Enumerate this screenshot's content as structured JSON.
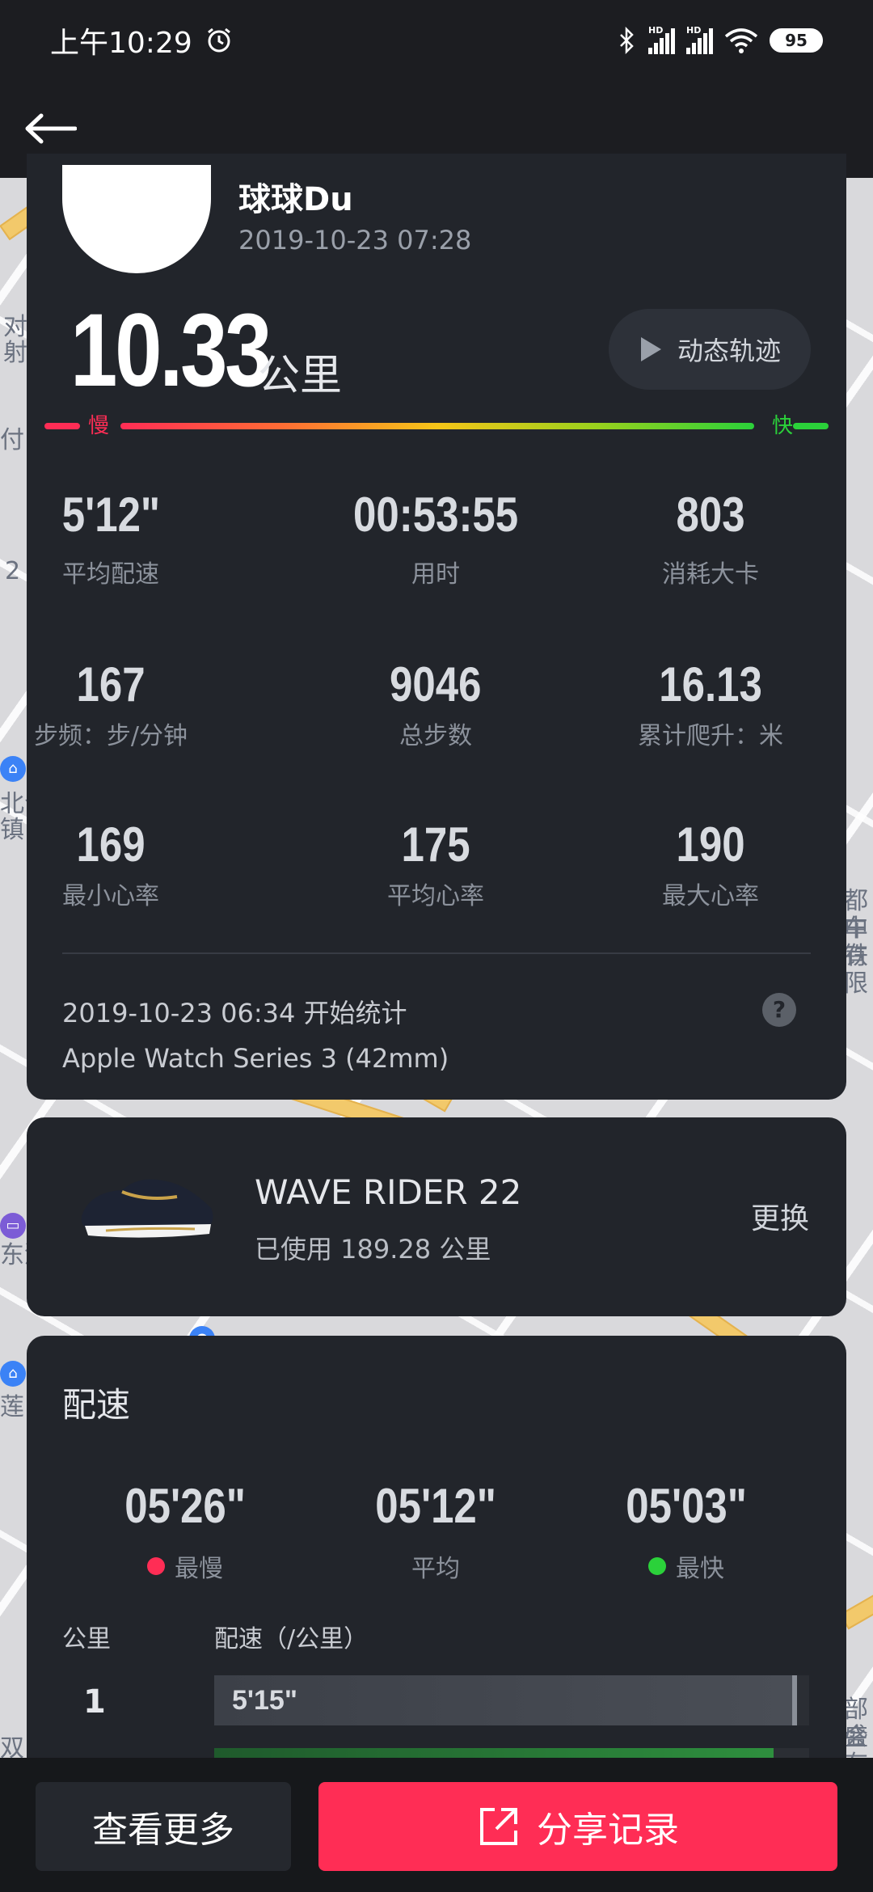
{
  "status_bar": {
    "time": "上午10:29",
    "battery": "95"
  },
  "nav": {
    "back_icon": "arrow-left-icon"
  },
  "summary": {
    "user_name": "球球Du",
    "record_time": "2019-10-23 07:28",
    "distance": "10.33",
    "distance_unit": "公里",
    "track_button": "动态轨迹",
    "pace_scale": {
      "slow": "慢",
      "fast": "快"
    },
    "stats": [
      {
        "value": "5'12\"",
        "label": "平均配速"
      },
      {
        "value": "00:53:55",
        "label": "用时"
      },
      {
        "value": "803",
        "label": "消耗大卡"
      },
      {
        "value": "167",
        "label": "步频：步/分钟"
      },
      {
        "value": "9046",
        "label": "总步数"
      },
      {
        "value": "16.13",
        "label": "累计爬升：米"
      },
      {
        "value": "169",
        "label": "最小心率"
      },
      {
        "value": "175",
        "label": "平均心率"
      },
      {
        "value": "190",
        "label": "最大心率"
      }
    ],
    "start_info": "2019-10-23 06:34  开始统计",
    "device": "Apple Watch Series 3 (42mm)",
    "help_icon": "?"
  },
  "shoe": {
    "name": "WAVE RIDER 22",
    "usage": "已使用 189.28 公里",
    "change": "更换"
  },
  "pace": {
    "title": "配速",
    "slowest": {
      "value": "05'26\"",
      "label": "最慢",
      "color": "#ff2d55"
    },
    "average": {
      "value": "05'12\"",
      "label": "平均"
    },
    "fastest": {
      "value": "05'03\"",
      "label": "最快",
      "color": "#2bd13a"
    },
    "col_km": "公里",
    "col_pace": "配速（/公里）",
    "rows": [
      {
        "km": "1",
        "pace": "5'15\"",
        "fill": 0.98
      },
      {
        "km": "",
        "pace": "",
        "fill": 0.94
      }
    ]
  },
  "bottom": {
    "more": "查看更多",
    "share": "分享记录"
  },
  "map": {
    "labels": [
      "对",
      "射",
      "付",
      "2",
      "北仑",
      "镇",
      "莲",
      "都中",
      "车铁",
      "有限",
      "部盛",
      "会有",
      "双",
      "东酒"
    ]
  }
}
